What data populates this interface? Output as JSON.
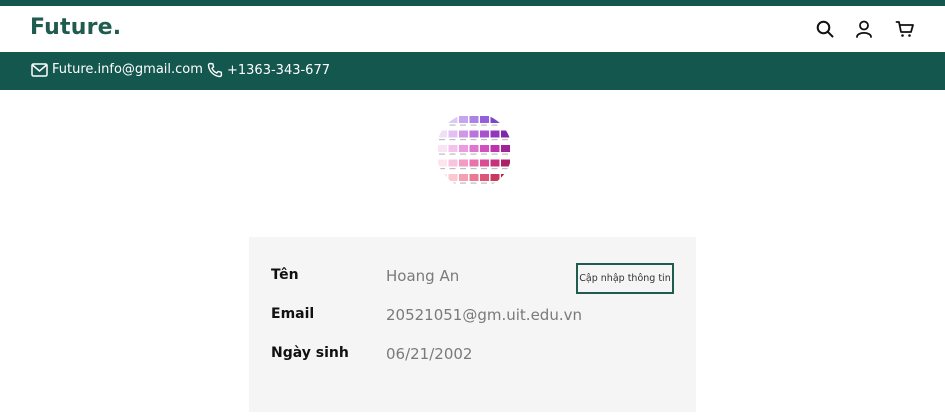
{
  "brand": {
    "logo_text": "Future.",
    "primary_color": "#14574f"
  },
  "header_icons": [
    "search-icon",
    "user-icon",
    "cart-icon"
  ],
  "contact": {
    "email": "Future.info@gmail.com",
    "phone": "+1363-343-677"
  },
  "profile": {
    "update_button_label": "Cập nhập thông tin",
    "fields": [
      {
        "label": "Tên",
        "value": "Hoang An"
      },
      {
        "label": "Email",
        "value": "20521051@gm.uit.edu.vn"
      },
      {
        "label": "Ngày sinh",
        "value": "06/21/2002"
      }
    ]
  }
}
